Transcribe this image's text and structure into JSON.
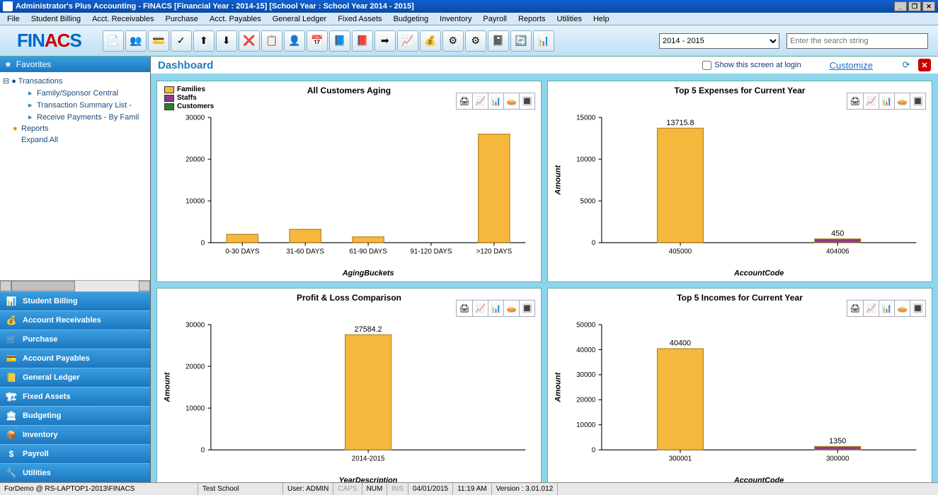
{
  "title": "Administrator's Plus Accounting - FINACS [Financial Year : 2014-15]  [School Year : School Year 2014 - 2015]",
  "menu": [
    "File",
    "Student Billing",
    "Acct. Receivables",
    "Purchase",
    "Acct. Payables",
    "General Ledger",
    "Fixed Assets",
    "Budgeting",
    "Inventory",
    "Payroll",
    "Reports",
    "Utilities",
    "Help"
  ],
  "logo_main": "FIN",
  "logo_accent": "AC",
  "logo_tail": "S",
  "year_select": "2014 - 2015",
  "search_placeholder": "Enter the search string",
  "favorites_label": "Favorites",
  "tree": {
    "transactions": "Transactions",
    "children": [
      "Family/Sponsor Central",
      "Transaction Summary List -",
      "Receive Payments - By Famil"
    ],
    "reports": "Reports",
    "expand": "Expand All"
  },
  "modules": [
    "Student Billing",
    "Account Receivables",
    "Purchase",
    "Account Payables",
    "General Ledger",
    "Fixed Assets",
    "Budgeting",
    "Inventory",
    "Payroll",
    "Utilities"
  ],
  "dashboard": {
    "title": "Dashboard",
    "show_login": "Show this screen at login",
    "customize": "Customize"
  },
  "statusbar": {
    "demo": "ForDemo @ RS-LAPTOP1-2013\\FINACS",
    "school": "Test School",
    "user": "User: ADMIN",
    "caps": "CAPS",
    "num": "NUM",
    "ins": "INS",
    "date": "04/01/2015",
    "time": "11:19 AM",
    "version": "Version : 3.01.012"
  },
  "chart_data": [
    {
      "id": "aging",
      "type": "bar",
      "title": "All Customers Aging",
      "legend": [
        {
          "name": "Families",
          "color": "#f5b83d"
        },
        {
          "name": "Staffs",
          "color": "#8b3a8b"
        },
        {
          "name": "Customers",
          "color": "#2d7a2d"
        }
      ],
      "series": [
        {
          "name": "Families",
          "values": [
            2000,
            3200,
            1400,
            0,
            26000
          ]
        }
      ],
      "categories": [
        "0-30 DAYS",
        "31-60 DAYS",
        "61-90 DAYS",
        "91-120 DAYS",
        ">120 DAYS"
      ],
      "xlabel": "AgingBuckets",
      "ylabel": "",
      "ylim": [
        0,
        30000
      ],
      "yticks": [
        0,
        10000,
        20000,
        30000
      ]
    },
    {
      "id": "expenses",
      "type": "bar",
      "title": "Top 5 Expenses for Current Year",
      "series": [
        {
          "name": "Amount",
          "values": [
            13715.8,
            450
          ],
          "colors": [
            "#f5b83d",
            "#8b3a8b"
          ],
          "show_values": true
        }
      ],
      "categories": [
        "405000",
        "404006"
      ],
      "xlabel": "AccountCode",
      "ylabel": "Amount",
      "ylim": [
        0,
        15000
      ],
      "yticks": [
        0,
        5000,
        10000,
        15000
      ]
    },
    {
      "id": "pl",
      "type": "bar",
      "title": "Profit & Loss Comparison",
      "series": [
        {
          "name": "Amount",
          "values": [
            27584.2
          ],
          "colors": [
            "#f5b83d"
          ],
          "show_values": true
        }
      ],
      "categories": [
        "2014-2015"
      ],
      "xlabel": "YearDescription",
      "ylabel": "Amount",
      "ylim": [
        0,
        30000
      ],
      "yticks": [
        0,
        10000,
        20000,
        30000
      ]
    },
    {
      "id": "incomes",
      "type": "bar",
      "title": "Top 5 Incomes for Current Year",
      "series": [
        {
          "name": "Amount",
          "values": [
            40400,
            1350
          ],
          "colors": [
            "#f5b83d",
            "#8b3a8b"
          ],
          "show_values": true
        }
      ],
      "categories": [
        "300001",
        "300000"
      ],
      "xlabel": "AccountCode",
      "ylabel": "Amount",
      "ylim": [
        0,
        50000
      ],
      "yticks": [
        0,
        10000,
        20000,
        30000,
        40000,
        50000
      ]
    }
  ]
}
